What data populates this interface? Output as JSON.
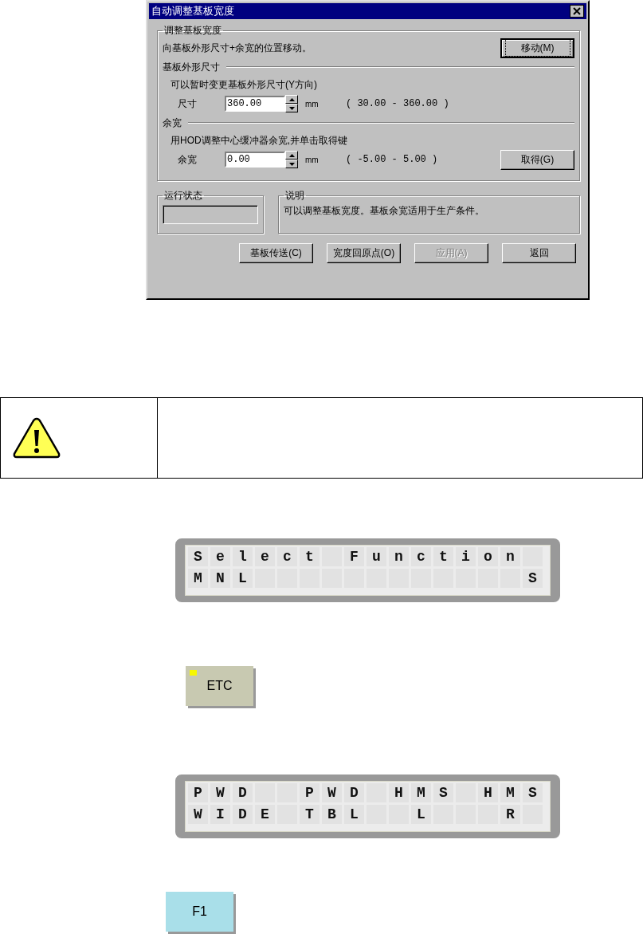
{
  "dialog": {
    "title": "自动调整基板宽度",
    "adjust_group": {
      "label": "调整基板宽度",
      "hint": "向基板外形尺寸+余宽的位置移动。",
      "move_button": {
        "label": "移动(M)",
        "default": true
      },
      "sections": [
        {
          "heading": "基板外形尺寸",
          "hint": "可以暂时变更基板外形尺寸(Y方向)",
          "field_label": "尺寸",
          "value": "360.00",
          "unit": "mm",
          "range": "( 30.00 - 360.00 )"
        },
        {
          "heading": "余宽",
          "hint": "用HOD调整中心缓冲器余宽,并单击取得键",
          "field_label": "余宽",
          "value": "0.00",
          "unit": "mm",
          "range": "( -5.00 - 5.00 )",
          "button": {
            "label": "取得(G)"
          }
        }
      ]
    },
    "status_group": {
      "label": "运行状态"
    },
    "description_group": {
      "label": "说明",
      "text": "可以调整基板宽度。基板余宽适用于生产条件。"
    },
    "buttons": [
      {
        "label": "基板传送(C)",
        "disabled": false
      },
      {
        "label": "宽度回原点(O)",
        "disabled": false
      },
      {
        "label": "应用(A)",
        "disabled": true
      },
      {
        "label": "返回",
        "disabled": false
      }
    ]
  },
  "notice": {
    "kind": "warning"
  },
  "panels": [
    {
      "kind": "lcd",
      "rows": [
        "Select Function ",
        "MNL            S"
      ]
    },
    {
      "kind": "key",
      "label": "ETC",
      "color": "#c8c9b1",
      "led": true
    },
    {
      "kind": "lcd",
      "rows": [
        "PWD  PWD HMS HMS",
        "WIDE TBL  L   R "
      ]
    },
    {
      "kind": "key",
      "label": "F1",
      "color": "#a9dfe9",
      "led": false
    }
  ]
}
